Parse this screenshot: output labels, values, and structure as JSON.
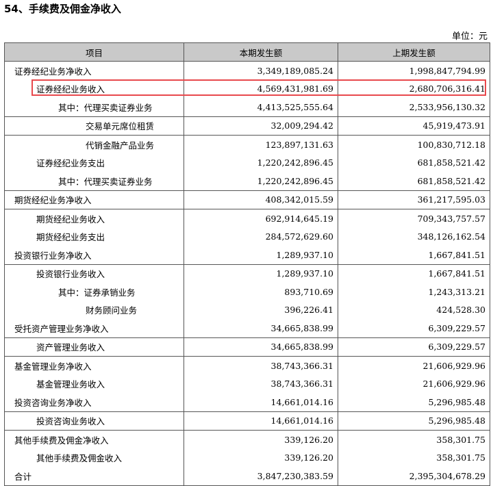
{
  "title": "54、手续费及佣金净收入",
  "unit": "单位：元",
  "table": {
    "headers": [
      "项目",
      "本期发生额",
      "上期发生额"
    ],
    "rows": [
      {
        "label": "证券经纪业务净收入",
        "current": "3,349,189,085.24",
        "prior": "1,998,847,794.99"
      },
      {
        "label": "证券经纪业务收入",
        "current": "4,569,431,981.69",
        "prior": "2,680,706,316.41"
      },
      {
        "label": "其中：代理买卖证券业务",
        "current": "4,413,525,555.64",
        "prior": "2,533,956,130.32"
      },
      {
        "label": "交易单元席位租赁",
        "current": "32,009,294.42",
        "prior": "45,919,473.91"
      },
      {
        "label": "代销金融产品业务",
        "current": "123,897,131.63",
        "prior": "100,830,712.18"
      },
      {
        "label": "证券经纪业务支出",
        "current": "1,220,242,896.45",
        "prior": "681,858,521.42"
      },
      {
        "label": "其中：代理买卖证券业务",
        "current": "1,220,242,896.45",
        "prior": "681,858,521.42"
      },
      {
        "label": "期货经纪业务净收入",
        "current": "408,342,015.59",
        "prior": "361,217,595.03"
      },
      {
        "label": "期货经纪业务收入",
        "current": "692,914,645.19",
        "prior": "709,343,757.57"
      },
      {
        "label": "期货经纪业务支出",
        "current": "284,572,629.60",
        "prior": "348,126,162.54"
      },
      {
        "label": "投资银行业务净收入",
        "current": "1,289,937.10",
        "prior": "1,667,841.51"
      },
      {
        "label": "投资银行业务收入",
        "current": "1,289,937.10",
        "prior": "1,667,841.51"
      },
      {
        "label": "其中：证券承销业务",
        "current": "893,710.69",
        "prior": "1,243,313.21"
      },
      {
        "label": "财务顾问业务",
        "current": "396,226.41",
        "prior": "424,528.30"
      },
      {
        "label": "受托资产管理业务净收入",
        "current": "34,665,838.99",
        "prior": "6,309,229.57"
      },
      {
        "label": "资产管理业务收入",
        "current": "34,665,838.99",
        "prior": "6,309,229.57"
      },
      {
        "label": "基金管理业务净收入",
        "current": "38,743,366.31",
        "prior": "21,606,929.96"
      },
      {
        "label": "基金管理业务收入",
        "current": "38,743,366.31",
        "prior": "21,606,929.96"
      },
      {
        "label": "投资咨询业务净收入",
        "current": "14,661,014.16",
        "prior": "5,296,985.48"
      },
      {
        "label": "投资咨询业务收入",
        "current": "14,661,014.16",
        "prior": "5,296,985.48"
      },
      {
        "label": "其他手续费及佣金净收入",
        "current": "339,126.20",
        "prior": "358,301.75"
      },
      {
        "label": "其他手续费及佣金收入",
        "current": "339,126.20",
        "prior": "358,301.75"
      },
      {
        "label": "合计",
        "current": "3,847,230,383.59",
        "prior": "2,395,304,678.29"
      }
    ]
  },
  "highlight_color": "#e8484c",
  "header_bg": "#c9c9c9"
}
